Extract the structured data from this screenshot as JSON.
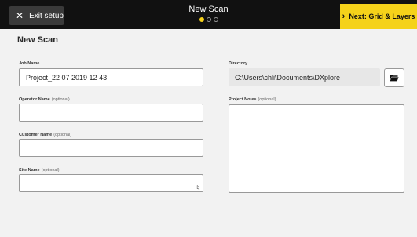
{
  "header": {
    "exit_label": "Exit setup",
    "title": "New Scan",
    "next_label": "Next: Grid & Layers",
    "steps": [
      true,
      false,
      false
    ]
  },
  "page": {
    "heading": "New Scan"
  },
  "form": {
    "job_name": {
      "label": "Job Name",
      "value": "Project_22 07 2019 12 43"
    },
    "operator_name": {
      "label": "Operator Name",
      "optional": "(optional)",
      "value": ""
    },
    "customer_name": {
      "label": "Customer Name",
      "optional": "(optional)",
      "value": ""
    },
    "site_name": {
      "label": "Site Name",
      "optional": "(optional)",
      "value": ""
    },
    "directory": {
      "label": "Directory",
      "value": "C:\\Users\\chli\\Documents\\DXplore"
    },
    "project_notes": {
      "label": "Project Notes",
      "optional": "(optional)",
      "value": ""
    }
  },
  "icons": {
    "exit": "close-icon",
    "next": "chevron-right-icon",
    "folder": "folder-open-icon",
    "cursor": "mouse-pointer-icon"
  },
  "colors": {
    "topbar": "#111111",
    "accent": "#f5d21a",
    "background": "#f2f2f2"
  }
}
